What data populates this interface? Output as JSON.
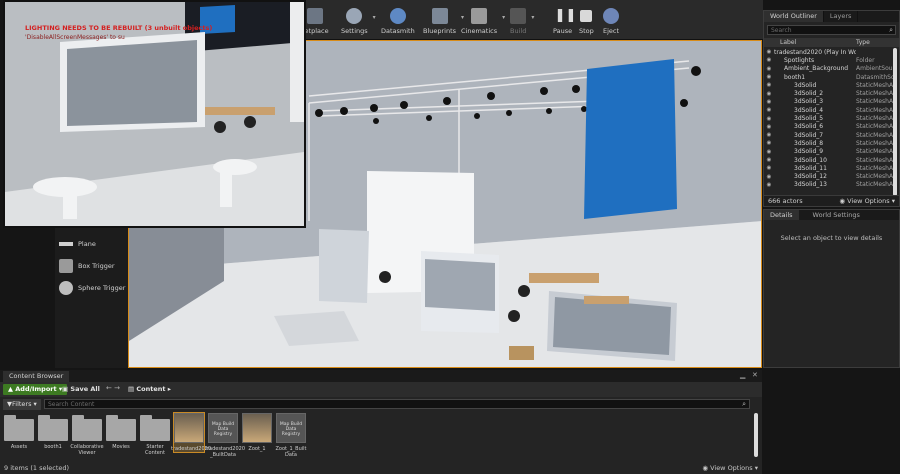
{
  "toolbar": {
    "buttons": [
      {
        "label": "ketplace",
        "icon": "marketplace-icon"
      },
      {
        "label": "Settings",
        "icon": "gear-icon"
      },
      {
        "label": "Datasmith",
        "icon": "datasmith-icon"
      },
      {
        "label": "Blueprints",
        "icon": "blueprint-icon"
      },
      {
        "label": "Cinematics",
        "icon": "clapperboard-icon"
      },
      {
        "label": "Build",
        "icon": "build-icon"
      },
      {
        "label": "Pause",
        "icon": "pause-icon"
      },
      {
        "label": "Stop",
        "icon": "stop-icon"
      },
      {
        "label": "Eject",
        "icon": "eject-icon"
      }
    ]
  },
  "overlay": {
    "warning": "LIGHTING NEEDS TO BE REBUILT (3 unbuilt objects)",
    "sub": "'DisableAllScreenMessages' to su"
  },
  "place_actors": {
    "items": [
      {
        "label": "Plane"
      },
      {
        "label": "Box Trigger"
      },
      {
        "label": "Sphere Trigger"
      }
    ]
  },
  "outliner": {
    "tabs": [
      "World Outliner",
      "Layers"
    ],
    "search_placeholder": "Search",
    "columns": {
      "label": "Label",
      "type": "Type"
    },
    "rows": [
      {
        "name": "tradestand2020 (Play In World",
        "type": ""
      },
      {
        "name": "Spotlights",
        "type": "Folder"
      },
      {
        "name": "Ambient_Background",
        "type": "AmbientSou"
      },
      {
        "name": "booth1",
        "type": "DatasmithSc"
      },
      {
        "name": "3dSolid",
        "type": "StaticMeshA"
      },
      {
        "name": "3dSolid_2",
        "type": "StaticMeshA"
      },
      {
        "name": "3dSolid_3",
        "type": "StaticMeshA"
      },
      {
        "name": "3dSolid_4",
        "type": "StaticMeshA"
      },
      {
        "name": "3dSolid_5",
        "type": "StaticMeshA"
      },
      {
        "name": "3dSolid_6",
        "type": "StaticMeshA"
      },
      {
        "name": "3dSolid_7",
        "type": "StaticMeshA"
      },
      {
        "name": "3dSolid_8",
        "type": "StaticMeshA"
      },
      {
        "name": "3dSolid_9",
        "type": "StaticMeshA"
      },
      {
        "name": "3dSolid_10",
        "type": "StaticMeshA"
      },
      {
        "name": "3dSolid_11",
        "type": "StaticMeshA"
      },
      {
        "name": "3dSolid_12",
        "type": "StaticMeshA"
      },
      {
        "name": "3dSolid_13",
        "type": "StaticMeshA"
      }
    ],
    "count": "666 actors",
    "view_options": "View Options"
  },
  "details": {
    "tabs": [
      "Details",
      "World Settings"
    ],
    "message": "Select an object to view details"
  },
  "content_browser": {
    "tab": "Content Browser",
    "add_import": "Add/Import",
    "save_all": "Save All",
    "breadcrumb": "Content",
    "filters": "Filters",
    "search_placeholder": "Search Content",
    "tiles": [
      {
        "label": "Assets",
        "kind": "folder"
      },
      {
        "label": "booth1",
        "kind": "folder"
      },
      {
        "label": "Collaborative Viewer",
        "kind": "folder"
      },
      {
        "label": "Movies",
        "kind": "folder"
      },
      {
        "label": "Starter Content",
        "kind": "folder"
      },
      {
        "label": "tradestand2020",
        "kind": "level",
        "selected": true
      },
      {
        "label": "tradestand2020 _BuiltData",
        "kind": "mbd"
      },
      {
        "label": "Zoot_1",
        "kind": "level"
      },
      {
        "label": "Zoot_1_Built Data",
        "kind": "mbd"
      }
    ],
    "mbd_caption": "Map Build Data Registry",
    "status": "9 items (1 selected)",
    "view_options": "View Options"
  }
}
